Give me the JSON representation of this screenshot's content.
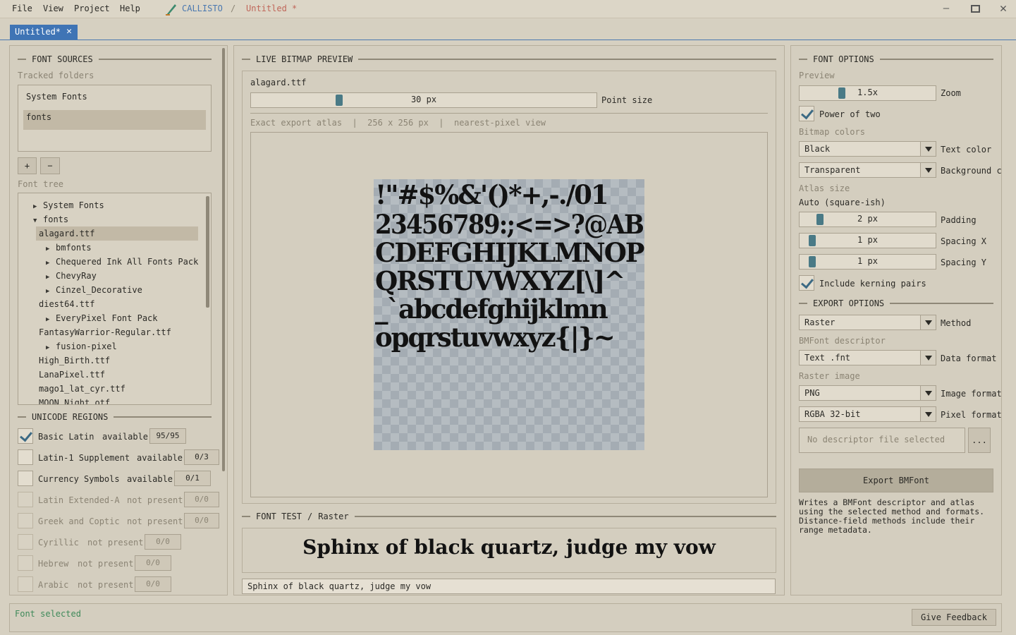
{
  "menu": {
    "file": "File",
    "view": "View",
    "project": "Project",
    "help": "Help"
  },
  "app": {
    "name": "CALLISTO",
    "separator": "/",
    "document": "Untitled *"
  },
  "tab": {
    "label": "Untitled*",
    "close": "✕"
  },
  "font_sources": {
    "title": "FONT SOURCES",
    "tracked_label": "Tracked folders",
    "folders": [
      "System Fonts",
      "fonts"
    ],
    "add_label": "+",
    "remove_label": "−",
    "tree_label": "Font tree",
    "tree": [
      {
        "label": "System Fonts",
        "arrow": "▶"
      },
      {
        "label": "fonts",
        "arrow": "▼"
      },
      {
        "label": "alagard.ttf",
        "arrow": ""
      },
      {
        "label": "bmfonts",
        "arrow": "▶"
      },
      {
        "label": "Chequered Ink All Fonts Pack",
        "arrow": "▶"
      },
      {
        "label": "ChevyRay",
        "arrow": "▶"
      },
      {
        "label": "Cinzel_Decorative",
        "arrow": "▶"
      },
      {
        "label": "diest64.ttf",
        "arrow": ""
      },
      {
        "label": "EveryPixel Font Pack",
        "arrow": "▶"
      },
      {
        "label": "FantasyWarrior-Regular.ttf",
        "arrow": ""
      },
      {
        "label": "fusion-pixel",
        "arrow": "▶"
      },
      {
        "label": "High_Birth.ttf",
        "arrow": ""
      },
      {
        "label": "LanaPixel.ttf",
        "arrow": ""
      },
      {
        "label": "mago1_lat_cyr.ttf",
        "arrow": ""
      },
      {
        "label": "MOON Night.otf",
        "arrow": ""
      }
    ]
  },
  "unicode_regions": {
    "title": "UNICODE REGIONS",
    "items": [
      {
        "name": "Basic Latin",
        "status": "available",
        "count": "95/95",
        "checked": true
      },
      {
        "name": "Latin-1 Supplement",
        "status": "available",
        "count": "0/3",
        "checked": false
      },
      {
        "name": "Currency Symbols",
        "status": "available",
        "count": "0/1",
        "checked": false
      },
      {
        "name": "Latin Extended-A",
        "status": "not present",
        "count": "0/0",
        "checked": false
      },
      {
        "name": "Greek and Coptic",
        "status": "not present",
        "count": "0/0",
        "checked": false
      },
      {
        "name": "Cyrillic",
        "status": "not present",
        "count": "0/0",
        "checked": false
      },
      {
        "name": "Hebrew",
        "status": "not present",
        "count": "0/0",
        "checked": false
      },
      {
        "name": "Arabic",
        "status": "not present",
        "count": "0/0",
        "checked": false
      }
    ]
  },
  "preview": {
    "title": "LIVE BITMAP PREVIEW",
    "font_file": "alagard.ttf",
    "point_size_value": "30 px",
    "point_size_label": "Point size",
    "point_size_fraction": 0.25,
    "info": "Exact export atlas  |  256 x 256 px  |  nearest-pixel view",
    "atlas_lines": [
      "!\"#$%&'()*+,-./01",
      "23456789:;<=>?@AB",
      "CDEFGHIJKLMNOP",
      "QRSTUVWXYZ[\\]^",
      "_`abcdefghijklmn",
      "opqrstuvwxyz{|}~"
    ]
  },
  "font_test": {
    "title": "FONT TEST",
    "separator": "/",
    "mode": "Raster",
    "sample": "Sphinx of black quartz, judge my vow",
    "input_value": "Sphinx of black quartz, judge my vow"
  },
  "font_options": {
    "title": "FONT OPTIONS",
    "preview_label": "Preview",
    "zoom_value": "1.5x",
    "zoom_label": "Zoom",
    "zoom_fraction": 0.3,
    "power_of_two_label": "Power of two",
    "power_of_two": true,
    "bitmap_colors_label": "Bitmap colors",
    "text_color_value": "Black",
    "text_color_label": "Text color",
    "background_value": "Transparent",
    "background_label": "Background c",
    "atlas_size_label": "Atlas size",
    "atlas_size_value": "Auto (square-ish)",
    "padding_value": "2 px",
    "padding_label": "Padding",
    "spacing_x_value": "1 px",
    "spacing_x_label": "Spacing X",
    "spacing_y_value": "1 px",
    "spacing_y_label": "Spacing Y",
    "kerning_label": "Include kerning pairs",
    "kerning": true
  },
  "export_options": {
    "title": "EXPORT OPTIONS",
    "method_value": "Raster",
    "method_label": "Method",
    "descriptor_label": "BMFont descriptor",
    "data_format_value": "Text .fnt",
    "data_format_label": "Data format",
    "raster_label": "Raster image",
    "image_format_value": "PNG",
    "image_format_label": "Image format",
    "pixel_format_value": "RGBA 32-bit",
    "pixel_format_label": "Pixel format",
    "descriptor_placeholder": "No descriptor file selected",
    "browse_label": "...",
    "export_button": "Export BMFont",
    "help_lines": [
      "Writes a BMFont descriptor and atlas",
      "using the selected method and formats.",
      "Distance-field methods include their",
      "range metadata."
    ]
  },
  "status": {
    "text": "Font selected",
    "feedback_button": "Give Feedback"
  },
  "colors": {
    "accent": "#3f74b5",
    "slider_knob": "#4a7a86",
    "status_text": "#3f8a5a"
  }
}
